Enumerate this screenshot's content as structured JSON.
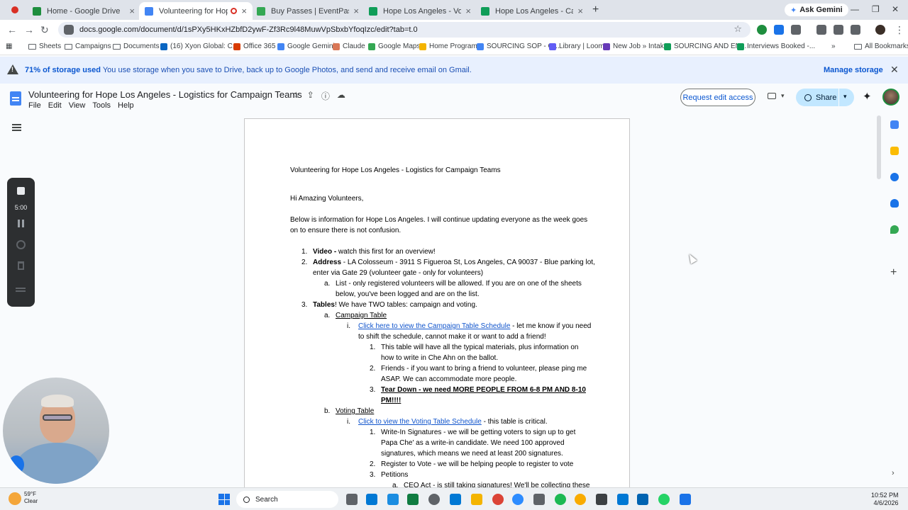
{
  "browser": {
    "tabs": [
      {
        "title": "Home - Google Drive",
        "favicon_color": "#1e8e3e",
        "active": false
      },
      {
        "title": "Volunteering for Hope Los A",
        "favicon_color": "#4285f4",
        "active": true
      },
      {
        "title": "Buy Passes | EventPass",
        "favicon_color": "#34a853",
        "active": false
      },
      {
        "title": "Hope Los Angeles - Voter Regi",
        "favicon_color": "#0f9d58",
        "active": false
      },
      {
        "title": "Hope Los Angeles - Campaign",
        "favicon_color": "#0f9d58",
        "active": false
      }
    ],
    "new_tab": "+",
    "ask_gemini": "Ask Gemini",
    "url": "docs.google.com/document/d/1sPXy5HKxHZbfD2ywF-Zf3Rc9l48MuwVpSbxbYfoqIzc/edit?tab=t.0",
    "bookmarks": [
      {
        "label": "Sheets",
        "icon": "folder-icon"
      },
      {
        "label": "Campaigns",
        "icon": "folder-icon"
      },
      {
        "label": "Documents",
        "icon": "folder-icon"
      },
      {
        "label": "(16) Xyon Global: C...",
        "icon": "linkedin-icon",
        "color": "#0a66c2"
      },
      {
        "label": "Office 365",
        "icon": "office-icon",
        "color": "#d83b01"
      },
      {
        "label": "Google Gemini",
        "icon": "gemini-icon",
        "color": "#4285f4"
      },
      {
        "label": "Claude",
        "icon": "claude-icon",
        "color": "#d97757"
      },
      {
        "label": "Google Maps",
        "icon": "maps-icon",
        "color": "#34a853"
      },
      {
        "label": "Home Program",
        "icon": "folder-icon",
        "color": "#f4b400"
      },
      {
        "label": "SOURCING SOP - G...",
        "icon": "google-icon",
        "color": "#4285f4"
      },
      {
        "label": "Library | Loom",
        "icon": "loom-icon",
        "color": "#625df5"
      },
      {
        "label": "New Job » Intake",
        "icon": "form-icon",
        "color": "#673ab7"
      },
      {
        "label": "SOURCING AND EN...",
        "icon": "sheets-icon",
        "color": "#0f9d58"
      },
      {
        "label": "Interviews Booked -...",
        "icon": "sheets-icon",
        "color": "#0f9d58"
      }
    ],
    "all_bookmarks": "All Bookmarks"
  },
  "banner": {
    "strong": "71% of storage used",
    "text": "You use storage when you save to Drive, back up to Google Photos, and send and receive email on Gmail.",
    "manage": "Manage storage"
  },
  "docs": {
    "title": "Volunteering for Hope Los Angeles - Logistics for Campaign Teams",
    "menu": [
      "File",
      "Edit",
      "View",
      "Tools",
      "Help"
    ],
    "request_edit": "Request edit access",
    "share": "Share"
  },
  "recorder": {
    "time": "5:00"
  },
  "document": {
    "heading": "Volunteering for Hope Los Angeles - Logistics for Campaign Teams",
    "greeting": "Hi Amazing Volunteers,",
    "intro_1": "Below is information for Hope Los Angeles. I will continue updating everyone as the week goes",
    "intro_2": "on to ensure there is not confusion.",
    "m1": "1.",
    "video_b": "Video -",
    "video_t": " watch this first for an overview!",
    "m2": "2.",
    "addr_b": "Address",
    "addr_t": " - LA Colosseum - 3911 S Figueroa St, Los Angeles, CA 90037 - Blue parking lot,",
    "addr_2": "enter via Gate 29 (volunteer gate - only for volunteers)",
    "ma": "a.",
    "list_1": "List - only registered volunteers will be allowed. If you are on one of the sheets",
    "list_2": "below, you've been logged and are on the list.",
    "m3": "3.",
    "tables_b": "Tables",
    "tables_t": "!  We have TWO tables: campaign and voting.",
    "ma2": "a.",
    "campaign_table": "Campaign Table",
    "mi": "i.",
    "campaign_link": "Click here to view the Campaign Table Schedule",
    "campaign_link_t": " - let me know if you need",
    "campaign_2": "to shift the schedule, cannot make it or want to add a friend!",
    "c1": "1.",
    "c1_1": "This table will have all the typical materials, plus information on",
    "c1_2": "how to write in Che Ahn on the ballot.",
    "c2": "2.",
    "c2_1": "Friends - if you want to bring a friend to volunteer, please ping me",
    "c2_2": "ASAP. We can accommodate more people.",
    "c3": "3.",
    "c3_1": "Tear Down - we need MORE PEOPLE FROM 6-8 PM AND 8-10",
    "c3_2": "PM!!!!",
    "mb": "b.",
    "voting_table": "Voting Table",
    "mi2": "i.",
    "voting_link": "Click to view the Voting Table Schedule",
    "voting_link_t": " - this table is critical.",
    "v1": "1.",
    "v1_1": "Write-In Signatures - we will be getting voters to sign up to get",
    "v1_2": "Papa Che' as a write-in candidate. We need 100 approved",
    "v1_3": "signatures, which means we need at least 200 signatures.",
    "v2": "2.",
    "v2_1": "Register to Vote - we will be helping people to register to vote",
    "v3": "3.",
    "v3_1": "Petitions",
    "va": "a.",
    "va_1": "CEO Act - is still taking signatures! We'll be collecting these"
  },
  "taskbar": {
    "temp": "59°F",
    "weather": "Clear",
    "search": "Search",
    "time": "10:52 PM",
    "date": "4/6/2026"
  }
}
